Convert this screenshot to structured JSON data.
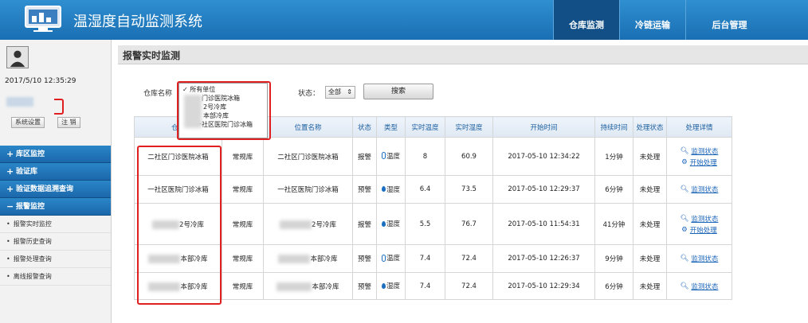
{
  "app": {
    "title": "温湿度自动监测系统"
  },
  "nav": [
    {
      "label": "仓库监测",
      "active": true
    },
    {
      "label": "冷链运输",
      "active": false
    },
    {
      "label": "后台管理",
      "active": false
    }
  ],
  "user": {
    "datetime": "2017/5/10 12:35:29",
    "buttons": {
      "left": "系统设置",
      "right": "注 销"
    }
  },
  "menu": [
    {
      "label": "库区监控",
      "sign": "+"
    },
    {
      "label": "验证库",
      "sign": "+"
    },
    {
      "label": "验证数据追溯查询",
      "sign": "+"
    },
    {
      "label": "报警监控",
      "sign": "−"
    }
  ],
  "submenu": [
    "报警实时监控",
    "报警历史查询",
    "报警处理查询",
    "离线报警查询"
  ],
  "page": {
    "title": "报警实时监测"
  },
  "filters": {
    "warehouse_label": "仓库名称",
    "status_label": "状态：",
    "status_value": "全部",
    "search_button": "搜索"
  },
  "dropdown_options": [
    "✓ 所有单位",
    "门诊医院冰箱",
    "2号冷库",
    "本部冷库",
    "一社区医院门诊冰箱"
  ],
  "table": {
    "headers": [
      "仓库",
      "",
      "位置名称",
      "状态",
      "类型",
      "实时温度",
      "实时湿度",
      "开始时间",
      "持续时间",
      "处理状态",
      "处理详情"
    ],
    "rows": [
      {
        "warehouse": "二社区门诊医院冰箱",
        "type_wh": "常规库",
        "location": "二社区门诊医院冰箱",
        "status": "报警",
        "kind": "温度",
        "temp": "8",
        "humidity": "60.9",
        "start": "2017-05-10 12:34:22",
        "duration": "1分钟",
        "handle": "未处理",
        "actions": [
          "监测状态",
          "开始处理"
        ]
      },
      {
        "warehouse": "一社区医院门诊冰箱",
        "type_wh": "常规库",
        "location": "一社区医院门诊冰箱",
        "status": "预警",
        "kind": "湿度",
        "temp": "6.4",
        "humidity": "73.5",
        "start": "2017-05-10 12:29:37",
        "duration": "6分钟",
        "handle": "未处理",
        "actions": [
          "监测状态"
        ]
      },
      {
        "warehouse": "2号冷库",
        "type_wh": "常规库",
        "location": "2号冷库",
        "status": "报警",
        "kind": "湿度",
        "temp": "5.5",
        "humidity": "76.7",
        "start": "2017-05-10 11:54:31",
        "duration": "41分钟",
        "handle": "未处理",
        "actions": [
          "监测状态",
          "开始处理"
        ]
      },
      {
        "warehouse": "本部冷库",
        "type_wh": "常规库",
        "location": "本部冷库",
        "status": "预警",
        "kind": "温度",
        "temp": "7.4",
        "humidity": "72.4",
        "start": "2017-05-10 12:26:37",
        "duration": "9分钟",
        "handle": "未处理",
        "actions": [
          "监测状态"
        ]
      },
      {
        "warehouse": "本部冷库",
        "type_wh": "常规库",
        "location": "本部冷库",
        "status": "预警",
        "kind": "湿度",
        "temp": "7.4",
        "humidity": "72.4",
        "start": "2017-05-10 12:29:34",
        "duration": "6分钟",
        "handle": "未处理",
        "actions": [
          "监测状态"
        ]
      }
    ]
  },
  "colors": {
    "header": "#1a6fb3",
    "nav_active": "#124f86",
    "alert_red": "#e02020",
    "link": "#1a64b8"
  }
}
